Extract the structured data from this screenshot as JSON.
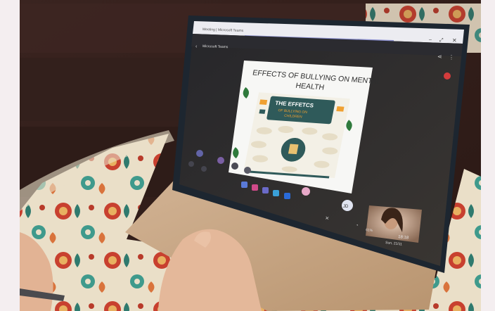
{
  "window": {
    "title": "Meeting | Microsoft Teams",
    "app_name": "Microsoft Teams"
  },
  "slide": {
    "title_line1": "EFFECTS OF BULLYING ON MENTAL",
    "title_line2": "HEALTH",
    "infographic_title": "THE EFFETCS",
    "infographic_subtitle": "OF BULLYING ON",
    "infographic_subtitle2": "CHILDREN"
  },
  "participant": {
    "initials": "JD"
  },
  "taskbar": {
    "battery": "61%",
    "time": "18:18",
    "date": "Sun, 21/11"
  },
  "colors": {
    "tablet_frame": "#1d2630",
    "screen_bg": "#2a2a2e",
    "slide_bg": "#f7f7f5",
    "infographic_bg": "#2f5a5a",
    "cover": "#c9a98a",
    "accent_orange": "#f0a030",
    "teams_purple": "#6264a7"
  }
}
